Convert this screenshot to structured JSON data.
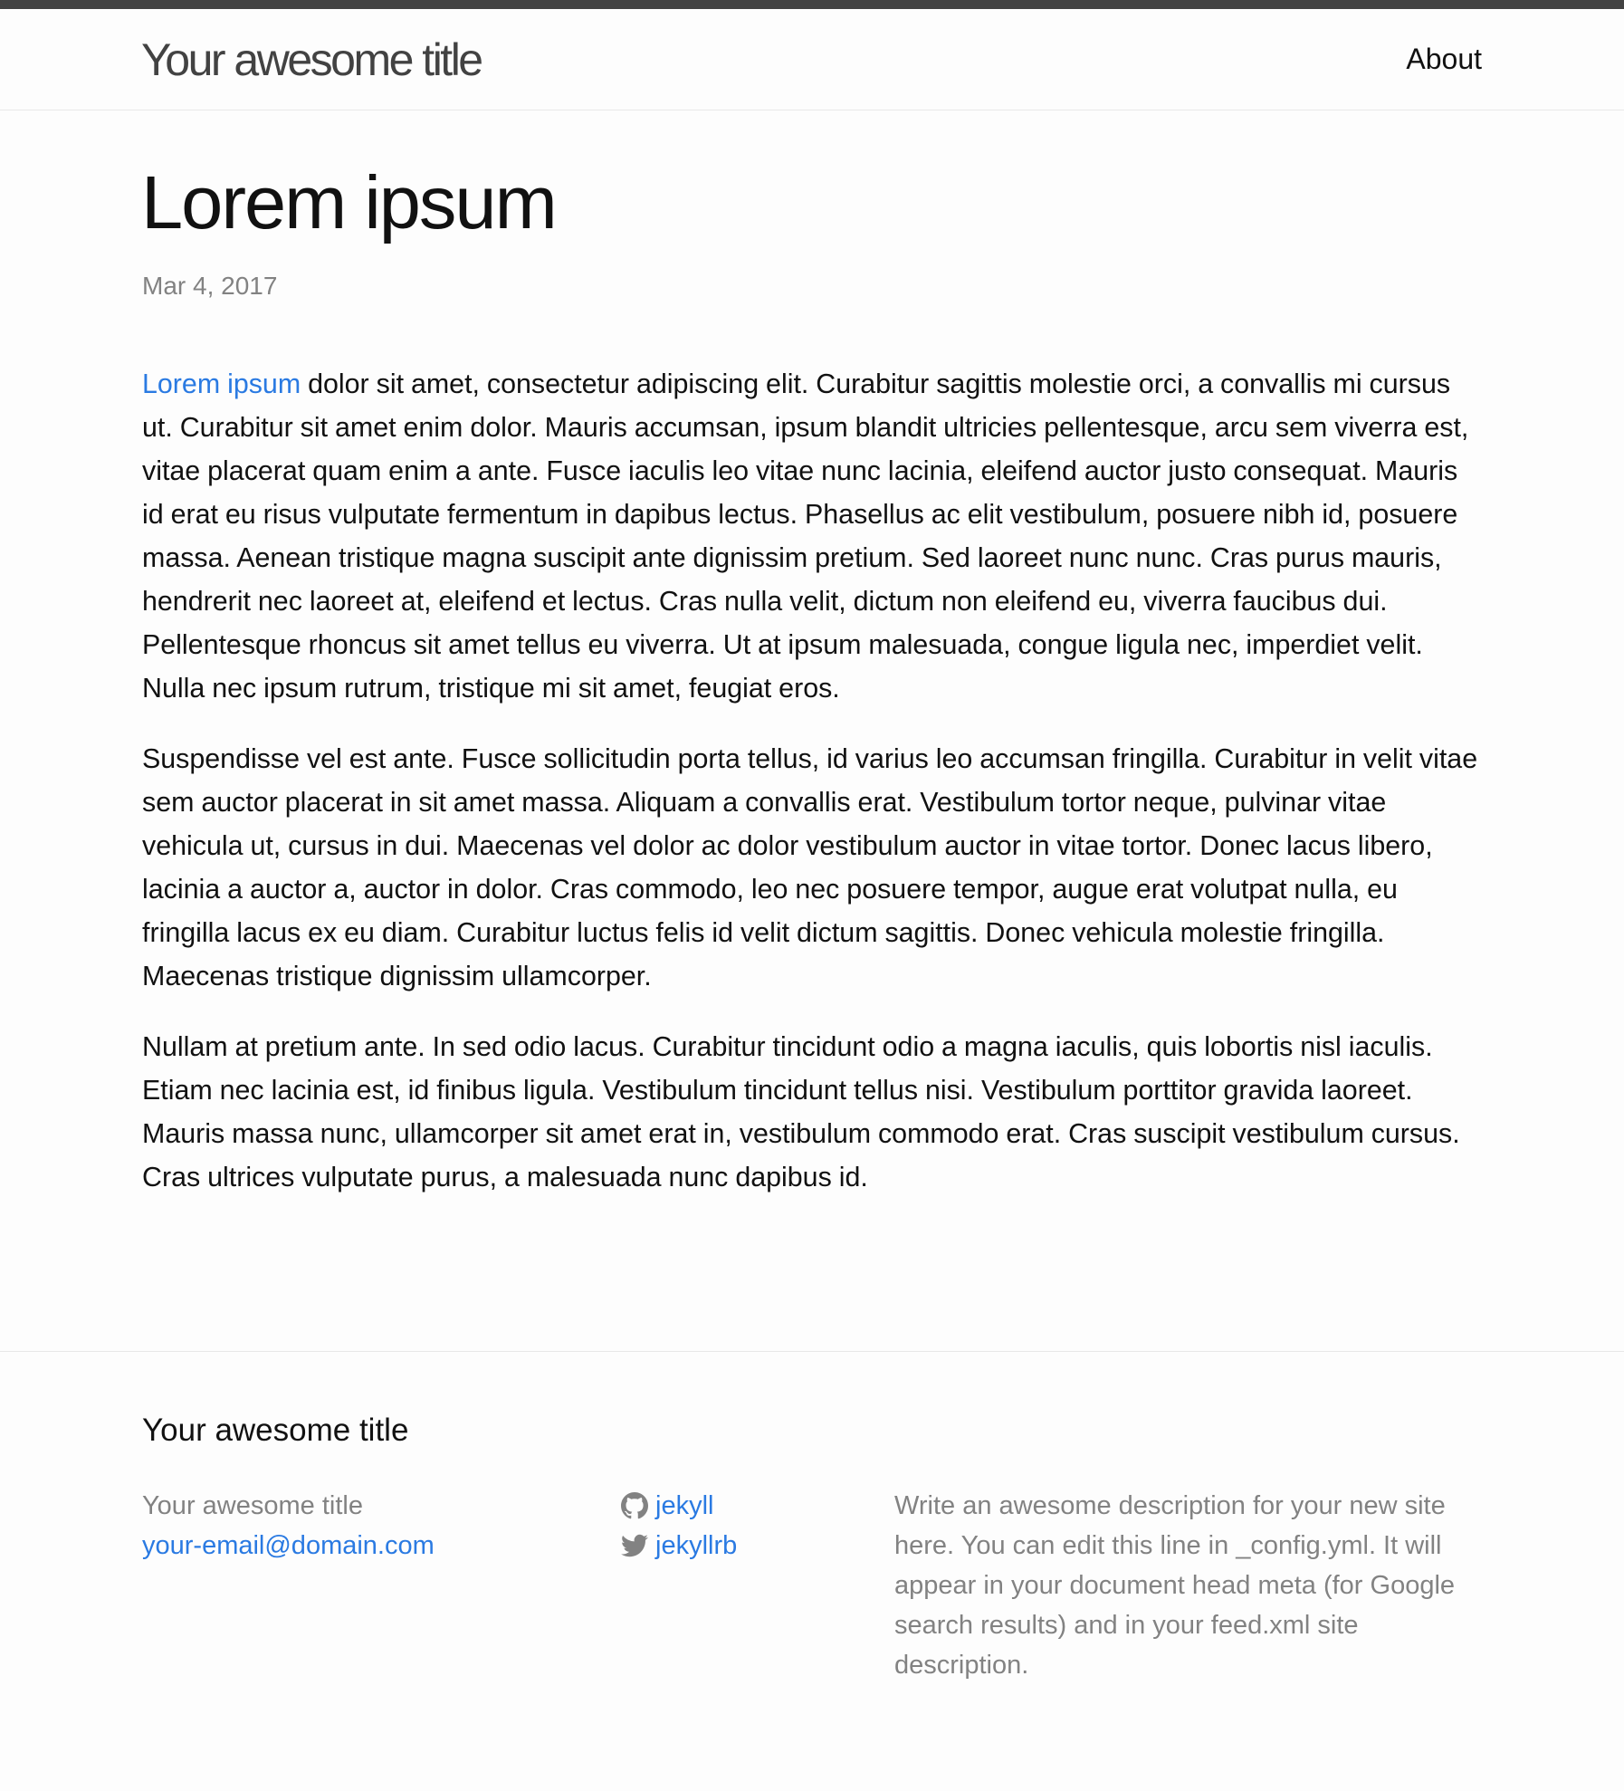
{
  "header": {
    "site_title": "Your awesome title",
    "nav": {
      "about_label": "About"
    }
  },
  "post": {
    "title": "Lorem ipsum",
    "date": "Mar 4, 2017",
    "paragraphs": {
      "p1_link": "Lorem ipsum",
      "p1_rest": " dolor sit amet, consectetur adipiscing elit. Curabitur sagittis molestie orci, a convallis mi cursus ut. Curabitur sit amet enim dolor. Mauris accumsan, ipsum blandit ultricies pellentesque, arcu sem viverra est, vitae placerat quam enim a ante. Fusce iaculis leo vitae nunc lacinia, eleifend auctor justo consequat. Mauris id erat eu risus vulputate fermentum in dapibus lectus. Phasellus ac elit vestibulum, posuere nibh id, posuere massa. Aenean tristique magna suscipit ante dignissim pretium. Sed laoreet nunc nunc. Cras purus mauris, hendrerit nec laoreet at, eleifend et lectus. Cras nulla velit, dictum non eleifend eu, viverra faucibus dui. Pellentesque rhoncus sit amet tellus eu viverra. Ut at ipsum malesuada, congue ligula nec, imperdiet velit. Nulla nec ipsum rutrum, tristique mi sit amet, feugiat eros.",
      "p2": "Suspendisse vel est ante. Fusce sollicitudin porta tellus, id varius leo accumsan fringilla. Curabitur in velit vitae sem auctor placerat in sit amet massa. Aliquam a convallis erat. Vestibulum tortor neque, pulvinar vitae vehicula ut, cursus in dui. Maecenas vel dolor ac dolor vestibulum auctor in vitae tortor. Donec lacus libero, lacinia a auctor a, auctor in dolor. Cras commodo, leo nec posuere tempor, augue erat volutpat nulla, eu fringilla lacus ex eu diam. Curabitur luctus felis id velit dictum sagittis. Donec vehicula molestie fringilla. Maecenas tristique dignissim ullamcorper.",
      "p3": "Nullam at pretium ante. In sed odio lacus. Curabitur tincidunt odio a magna iaculis, quis lobortis nisl iaculis. Etiam nec lacinia est, id finibus ligula. Vestibulum tincidunt tellus nisi. Vestibulum porttitor gravida laoreet. Mauris massa nunc, ullamcorper sit amet erat in, vestibulum commodo erat. Cras suscipit vestibulum cursus. Cras ultrices vulputate purus, a malesuada nunc dapibus id."
    }
  },
  "footer": {
    "heading": "Your awesome title",
    "contact": {
      "name": "Your awesome title",
      "email": "your-email@domain.com"
    },
    "social": {
      "github": {
        "icon": "github-icon",
        "username": "jekyll"
      },
      "twitter": {
        "icon": "twitter-icon",
        "username": "jekyllrb"
      }
    },
    "description": "Write an awesome description for your new site here. You can edit this line in _config.yml. It will appear in your document head meta (for Google search results) and in your feed.xml site description."
  },
  "colors": {
    "link": "#2a7ae2",
    "text": "#111111",
    "muted": "#828282",
    "top_bar": "#424242",
    "border": "#e8e8e8",
    "background": "#fdfdfd"
  }
}
